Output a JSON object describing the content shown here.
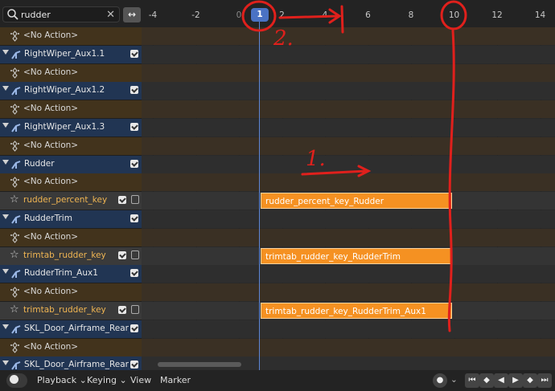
{
  "search": {
    "value": "rudder"
  },
  "ruler": {
    "ticks": [
      "-4",
      "-2",
      "0",
      "2",
      "4",
      "6",
      "8",
      "10",
      "12",
      "14"
    ],
    "current_frame": "1"
  },
  "rows": [
    {
      "type": "act",
      "label": "<No Action>"
    },
    {
      "type": "obj",
      "label": "RightWiper_Aux1.1"
    },
    {
      "type": "act",
      "label": "<No Action>"
    },
    {
      "type": "obj",
      "label": "RightWiper_Aux1.2"
    },
    {
      "type": "act",
      "label": "<No Action>"
    },
    {
      "type": "obj",
      "label": "RightWiper_Aux1.3"
    },
    {
      "type": "act",
      "label": "<No Action>"
    },
    {
      "type": "obj",
      "label": "Rudder"
    },
    {
      "type": "act",
      "label": "<No Action>"
    },
    {
      "type": "key",
      "label": "rudder_percent_key",
      "strip": "rudder_percent_key_Rudder"
    },
    {
      "type": "obj",
      "label": "RudderTrim"
    },
    {
      "type": "act",
      "label": "<No Action>"
    },
    {
      "type": "key",
      "label": "trimtab_rudder_key",
      "strip": "trimtab_rudder_key_RudderTrim"
    },
    {
      "type": "obj",
      "label": "RudderTrim_Aux1"
    },
    {
      "type": "act",
      "label": "<No Action>"
    },
    {
      "type": "key",
      "label": "trimtab_rudder_key",
      "strip": "trimtab_rudder_key_RudderTrim_Aux1"
    },
    {
      "type": "obj",
      "label": "SKL_Door_Airframe_Rear_Le"
    },
    {
      "type": "act",
      "label": "<No Action>"
    },
    {
      "type": "obj",
      "label": "SKL_Door_Airframe_Rear_Ri"
    }
  ],
  "bottom": {
    "playback": "Playback",
    "keying": "Keying",
    "view": "View",
    "marker": "Marker"
  },
  "annotations": {
    "label1": "1.",
    "label2": "2."
  },
  "colors": {
    "strip": "#f59122",
    "playhead": "#4a72c4",
    "annotation": "#e0201c"
  }
}
